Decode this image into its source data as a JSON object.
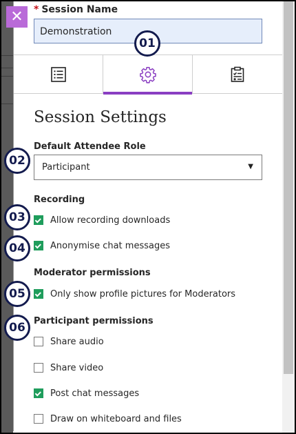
{
  "session": {
    "label": "Session Name",
    "required_mark": "*",
    "value": "Demonstration"
  },
  "close_glyph": "✕",
  "tabs": [
    {
      "icon": "list-icon",
      "active": false
    },
    {
      "icon": "gear-icon",
      "active": true
    },
    {
      "icon": "clipboard-checklist-icon",
      "active": false
    }
  ],
  "callouts": [
    "01",
    "02",
    "03",
    "04",
    "05",
    "06"
  ],
  "settings": {
    "title": "Session Settings",
    "default_role": {
      "label": "Default Attendee Role",
      "value": "Participant",
      "caret": "▼"
    },
    "recording": {
      "title": "Recording",
      "items": [
        {
          "label": "Allow recording downloads",
          "checked": true
        },
        {
          "label": "Anonymise chat messages",
          "checked": true
        }
      ]
    },
    "moderator": {
      "title": "Moderator permissions",
      "items": [
        {
          "label": "Only show profile pictures for Moderators",
          "checked": true
        }
      ]
    },
    "participant": {
      "title": "Participant permissions",
      "items": [
        {
          "label": "Share audio",
          "checked": false
        },
        {
          "label": "Share video",
          "checked": false
        },
        {
          "label": "Post chat messages",
          "checked": true
        },
        {
          "label": "Draw on whiteboard and files",
          "checked": false
        }
      ]
    }
  },
  "colors": {
    "accent": "#8a3ec2",
    "close_bg": "#b96ad8",
    "check": "#1f9d5c",
    "callout": "#131b4e",
    "input_bg": "#e6eefb"
  }
}
